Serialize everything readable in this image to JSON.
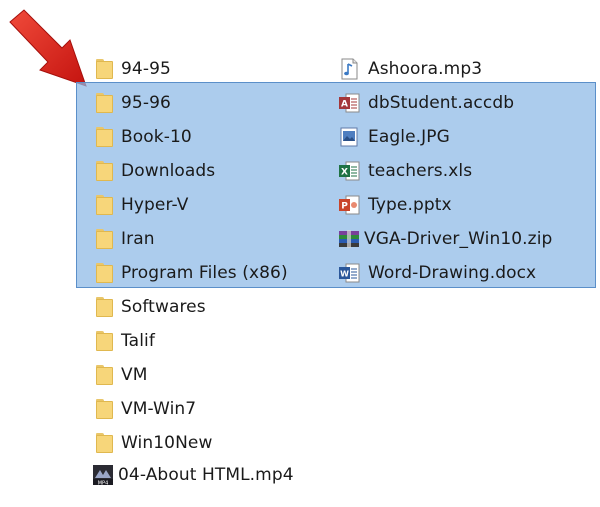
{
  "left_column": [
    {
      "label": "94-95",
      "icon": "folder-icon",
      "selected": false
    },
    {
      "label": "95-96",
      "icon": "folder-icon",
      "selected": true
    },
    {
      "label": "Book-10",
      "icon": "folder-icon",
      "selected": true
    },
    {
      "label": "Downloads",
      "icon": "folder-icon",
      "selected": true
    },
    {
      "label": "Hyper-V",
      "icon": "folder-icon",
      "selected": true
    },
    {
      "label": "Iran",
      "icon": "folder-icon",
      "selected": true
    },
    {
      "label": "Program Files (x86)",
      "icon": "folder-icon",
      "selected": true
    },
    {
      "label": "Softwares",
      "icon": "folder-icon",
      "selected": false
    },
    {
      "label": "Talif",
      "icon": "folder-icon",
      "selected": false
    },
    {
      "label": "VM",
      "icon": "folder-icon",
      "selected": false
    },
    {
      "label": "VM-Win7",
      "icon": "folder-icon",
      "selected": false
    },
    {
      "label": "Win10New",
      "icon": "folder-icon",
      "selected": false
    },
    {
      "label": "04-About HTML.mp4",
      "icon": "video-file-icon",
      "selected": false
    }
  ],
  "right_column": [
    {
      "label": "Ashoora.mp3",
      "icon": "audio-file-icon",
      "selected": false
    },
    {
      "label": "dbStudent.accdb",
      "icon": "access-file-icon",
      "selected": true
    },
    {
      "label": "Eagle.JPG",
      "icon": "image-file-icon",
      "selected": true
    },
    {
      "label": "teachers.xls",
      "icon": "excel-file-icon",
      "selected": true
    },
    {
      "label": "Type.pptx",
      "icon": "powerpoint-file-icon",
      "selected": true
    },
    {
      "label": "VGA-Driver_Win10.zip",
      "icon": "zip-file-icon",
      "selected": true
    },
    {
      "label": "Word-Drawing.docx",
      "icon": "word-file-icon",
      "selected": true
    }
  ],
  "colors": {
    "selection_fill": "#8cb9e6",
    "selection_border": "#5b8fc9",
    "folder": "#f7d67a",
    "arrow": "#e02020"
  }
}
